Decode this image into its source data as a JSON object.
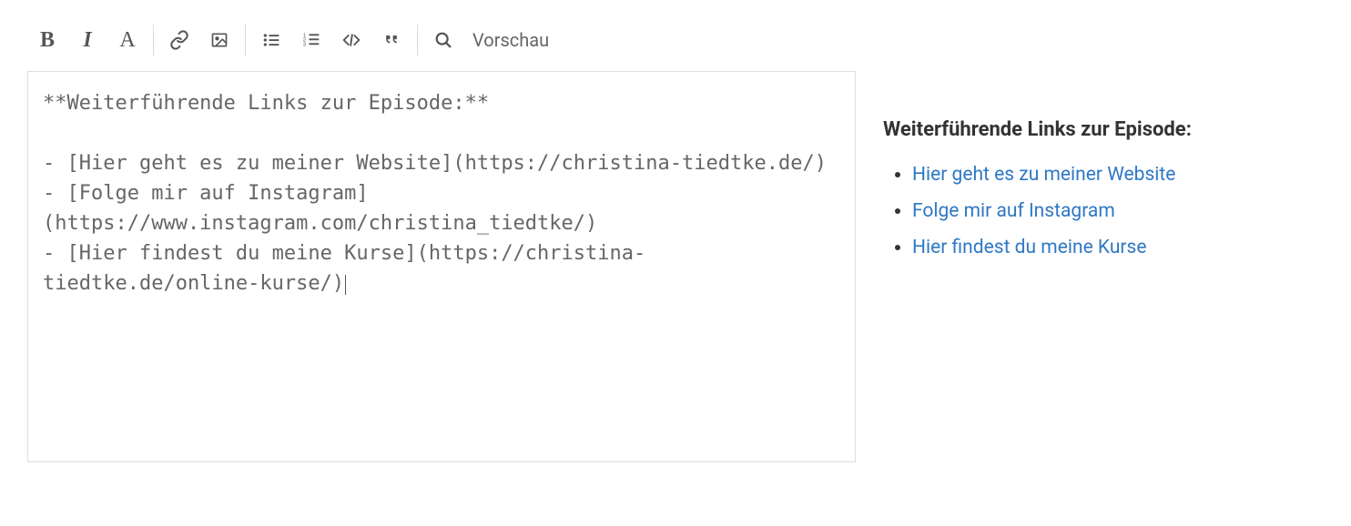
{
  "toolbar": {
    "bold_glyph": "B",
    "italic_glyph": "I",
    "font_glyph": "A",
    "preview_label": "Vorschau"
  },
  "editor": {
    "content": "**Weiterführende Links zur Episode:**\n\n- [Hier geht es zu meiner Website](https://christina-tiedtke.de/)\n- [Folge mir auf Instagram](https://www.instagram.com/christina_tiedtke/)\n- [Hier findest du meine Kurse](https://christina-tiedtke.de/online-kurse/)"
  },
  "preview": {
    "heading": "Weiterführende Links zur Episode:",
    "links": [
      "Hier geht es zu meiner Website",
      "Folge mir auf Instagram",
      "Hier findest du meine Kurse"
    ]
  }
}
